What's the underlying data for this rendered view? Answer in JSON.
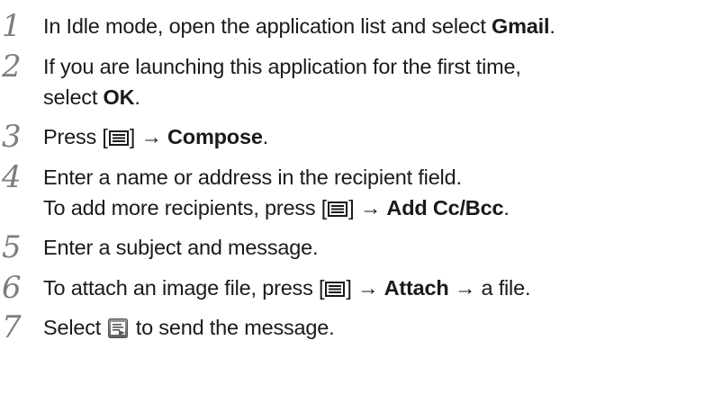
{
  "steps": [
    {
      "number": "1",
      "parts": {
        "t1": "In Idle mode, open the application list and select ",
        "b1": "Gmail",
        "t2": "."
      }
    },
    {
      "number": "2",
      "line1": "If you are launching this application for the first time,",
      "parts": {
        "t1": "select ",
        "b1": "OK",
        "t2": "."
      }
    },
    {
      "number": "3",
      "parts": {
        "t1": "Press [",
        "t2": "] → ",
        "b1": "Compose",
        "t3": "."
      }
    },
    {
      "number": "4",
      "line1": "Enter a name or address in the recipient field.",
      "parts": {
        "t1": "To add more recipients, press [",
        "t2": "] → ",
        "b1": "Add Cc/Bcc",
        "t3": "."
      }
    },
    {
      "number": "5",
      "line1": "Enter a subject and message."
    },
    {
      "number": "6",
      "parts": {
        "t1": "To attach an image file, press [",
        "t2": "] → ",
        "b1": "Attach",
        "t3": " → a file."
      }
    },
    {
      "number": "7",
      "parts": {
        "t1": "Select ",
        "t2": " to send the message."
      }
    }
  ],
  "icons": {
    "menu_key": "menu-key-icon",
    "send": "send-message-icon"
  }
}
